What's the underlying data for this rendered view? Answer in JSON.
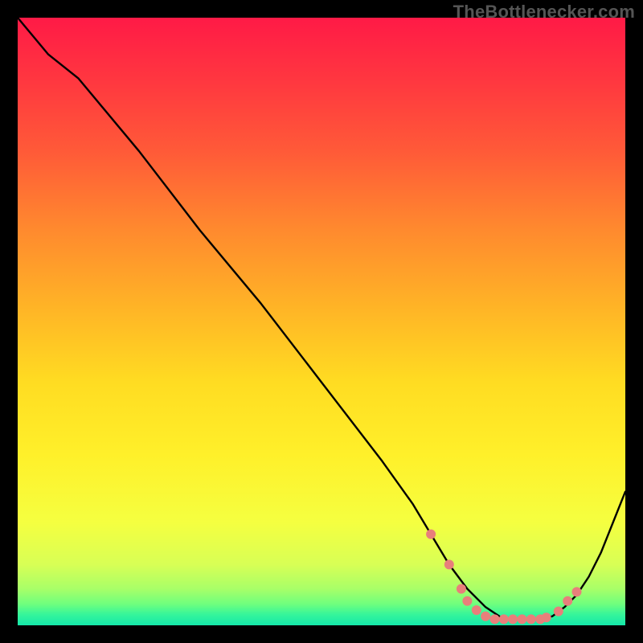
{
  "branding": "TheBottlenecker.com",
  "colors": {
    "page_bg": "#000000",
    "curve": "#000000",
    "dots": "#e87f7b",
    "gradient_stops": [
      {
        "offset": 0.0,
        "color": "#ff1a46"
      },
      {
        "offset": 0.1,
        "color": "#ff3640"
      },
      {
        "offset": 0.22,
        "color": "#ff5a38"
      },
      {
        "offset": 0.35,
        "color": "#ff8a2e"
      },
      {
        "offset": 0.48,
        "color": "#ffb526"
      },
      {
        "offset": 0.6,
        "color": "#ffdc22"
      },
      {
        "offset": 0.72,
        "color": "#fff02a"
      },
      {
        "offset": 0.83,
        "color": "#f5ff40"
      },
      {
        "offset": 0.9,
        "color": "#d8ff55"
      },
      {
        "offset": 0.94,
        "color": "#a8ff68"
      },
      {
        "offset": 0.965,
        "color": "#6fff7e"
      },
      {
        "offset": 0.982,
        "color": "#36f59a"
      },
      {
        "offset": 1.0,
        "color": "#14e8aa"
      }
    ]
  },
  "chart_data": {
    "type": "line",
    "title": "",
    "xlabel": "",
    "ylabel": "",
    "xlim": [
      0,
      100
    ],
    "ylim": [
      0,
      100
    ],
    "grid": false,
    "legend": false,
    "series": [
      {
        "name": "bottleneck-curve",
        "x": [
          0,
          5,
          10,
          20,
          30,
          40,
          50,
          60,
          65,
          68,
          71,
          74,
          77,
          80,
          83,
          86,
          88,
          90,
          92,
          94,
          96,
          100
        ],
        "y": [
          100,
          94,
          90,
          78,
          65,
          53,
          40,
          27,
          20,
          15,
          10,
          6,
          3,
          1,
          1,
          1,
          1.5,
          3,
          5,
          8,
          12,
          22
        ]
      }
    ],
    "markers": [
      {
        "x": 68,
        "y": 15
      },
      {
        "x": 71,
        "y": 10
      },
      {
        "x": 73,
        "y": 6
      },
      {
        "x": 74,
        "y": 4
      },
      {
        "x": 75.5,
        "y": 2.5
      },
      {
        "x": 77,
        "y": 1.5
      },
      {
        "x": 78.5,
        "y": 1
      },
      {
        "x": 80,
        "y": 1
      },
      {
        "x": 81.5,
        "y": 1
      },
      {
        "x": 83,
        "y": 1
      },
      {
        "x": 84.5,
        "y": 1
      },
      {
        "x": 86,
        "y": 1
      },
      {
        "x": 87,
        "y": 1.3
      },
      {
        "x": 89,
        "y": 2.3
      },
      {
        "x": 90.5,
        "y": 4
      },
      {
        "x": 92,
        "y": 5.5
      }
    ]
  }
}
